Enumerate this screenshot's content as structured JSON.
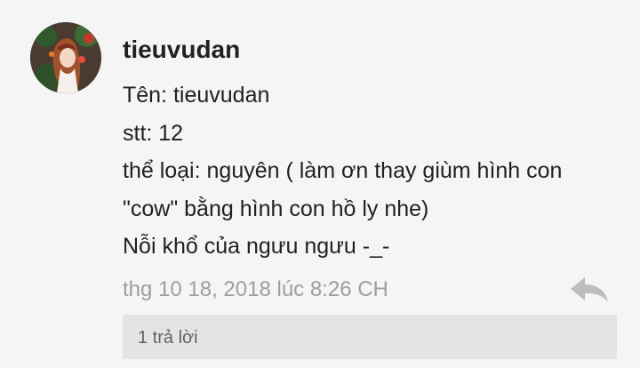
{
  "comment": {
    "avatar_icon": "user-avatar",
    "username": "tieuvudan",
    "lines": [
      "Tên: tieuvudan",
      "stt: 12",
      "thể loại: nguyên ( làm ơn thay giùm hình con",
      "\"cow\" bằng hình con hồ ly nhe)",
      "Nỗi khổ của ngưu ngưu -_-"
    ],
    "timestamp": "thg 10 18, 2018 lúc 8:26 CH",
    "reply_icon": "reply-arrow-icon",
    "replies_label": "1 trả lời"
  },
  "colors": {
    "background": "#f5f5f5",
    "text": "#212121",
    "muted": "#9e9e9e",
    "replies_bar": "#e4e4e4",
    "reply_icon": "#bdbdbd"
  }
}
